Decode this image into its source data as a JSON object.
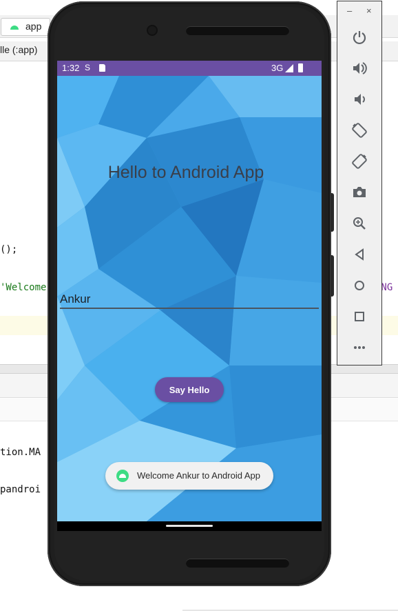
{
  "ide": {
    "run_config_label": "app",
    "module_tab": "lle (:app)",
    "code_lines": {
      "line1": "();",
      "line2": "'Welcome",
      "line2_right": "ONG",
      "line3": "tion.MA",
      "line4": "pandroi"
    }
  },
  "device": {
    "status_bar": {
      "time": "1:32",
      "network": "3G"
    },
    "app": {
      "title": "Hello to Android App",
      "name_input_value": "Ankur",
      "button_label": "Say Hello",
      "toast_text": "Welcome Ankur to Android App"
    }
  },
  "emulator_controls": {
    "minimize_label": "–",
    "close_label": "×",
    "buttons": [
      "power",
      "volume-up",
      "volume-down",
      "rotate-left",
      "rotate-right",
      "screenshot",
      "zoom",
      "back",
      "home",
      "overview",
      "more"
    ]
  },
  "colors": {
    "status_bar": "#6a4fa3",
    "accent": "#6a4fa3",
    "background_blue": "#3aa3e8",
    "toast_icon": "#3ddc84"
  }
}
